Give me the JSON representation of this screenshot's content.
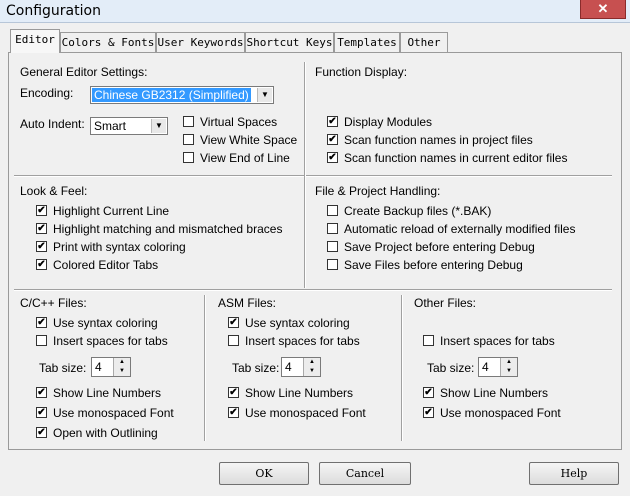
{
  "window": {
    "title": "Configuration",
    "close_glyph": "✕"
  },
  "tabs": [
    "Editor",
    "Colors & Fonts",
    "User Keywords",
    "Shortcut Keys",
    "Templates",
    "Other"
  ],
  "general": {
    "heading": "General Editor Settings:",
    "encoding_label": "Encoding:",
    "encoding_value": "Chinese GB2312 (Simplified)",
    "auto_indent_label": "Auto Indent:",
    "auto_indent_value": "Smart",
    "options": [
      {
        "label": "Virtual Spaces",
        "checked": false
      },
      {
        "label": "View White Space",
        "checked": false
      },
      {
        "label": "View End of Line",
        "checked": false
      }
    ]
  },
  "function_display": {
    "heading": "Function Display:",
    "options": [
      {
        "label": "Display Modules",
        "checked": true
      },
      {
        "label": "Scan function names in project files",
        "checked": true
      },
      {
        "label": "Scan function names in current editor files",
        "checked": true
      }
    ]
  },
  "look_feel": {
    "heading": "Look & Feel:",
    "options": [
      {
        "label": "Highlight Current Line",
        "checked": true
      },
      {
        "label": "Highlight matching and mismatched braces",
        "checked": true
      },
      {
        "label": "Print with syntax coloring",
        "checked": true
      },
      {
        "label": "Colored Editor Tabs",
        "checked": true
      }
    ]
  },
  "file_project": {
    "heading": "File & Project Handling:",
    "options": [
      {
        "label": "Create Backup files (*.BAK)",
        "checked": false
      },
      {
        "label": "Automatic reload of externally modified files",
        "checked": false
      },
      {
        "label": "Save Project before entering Debug",
        "checked": false
      },
      {
        "label": "Save Files before entering Debug",
        "checked": false
      }
    ]
  },
  "cpp_files": {
    "heading": "C/C++ Files:",
    "syntax": {
      "label": "Use syntax coloring",
      "checked": true
    },
    "insert_spaces": {
      "label": "Insert spaces for tabs",
      "checked": false
    },
    "tab_size_label": "Tab size:",
    "tab_size": "4",
    "line_numbers": {
      "label": "Show Line Numbers",
      "checked": true
    },
    "monospaced": {
      "label": "Use monospaced Font",
      "checked": true
    },
    "outlining": {
      "label": "Open with Outlining",
      "checked": true
    }
  },
  "asm_files": {
    "heading": "ASM Files:",
    "syntax": {
      "label": "Use syntax coloring",
      "checked": true
    },
    "insert_spaces": {
      "label": "Insert spaces for tabs",
      "checked": false
    },
    "tab_size_label": "Tab size:",
    "tab_size": "4",
    "line_numbers": {
      "label": "Show Line Numbers",
      "checked": true
    },
    "monospaced": {
      "label": "Use monospaced Font",
      "checked": true
    }
  },
  "other_files": {
    "heading": "Other Files:",
    "insert_spaces": {
      "label": "Insert spaces for tabs",
      "checked": false
    },
    "tab_size_label": "Tab size:",
    "tab_size": "4",
    "line_numbers": {
      "label": "Show Line Numbers",
      "checked": true
    },
    "monospaced": {
      "label": "Use monospaced Font",
      "checked": true
    }
  },
  "buttons": {
    "ok": "OK",
    "cancel": "Cancel",
    "help": "Help"
  },
  "glyphs": {
    "check": "✔",
    "dropdown": "▼",
    "spin_up": "▲",
    "spin_down": "▼"
  },
  "colors": {
    "selection": "#3399ff",
    "close_button": "#c75050"
  }
}
